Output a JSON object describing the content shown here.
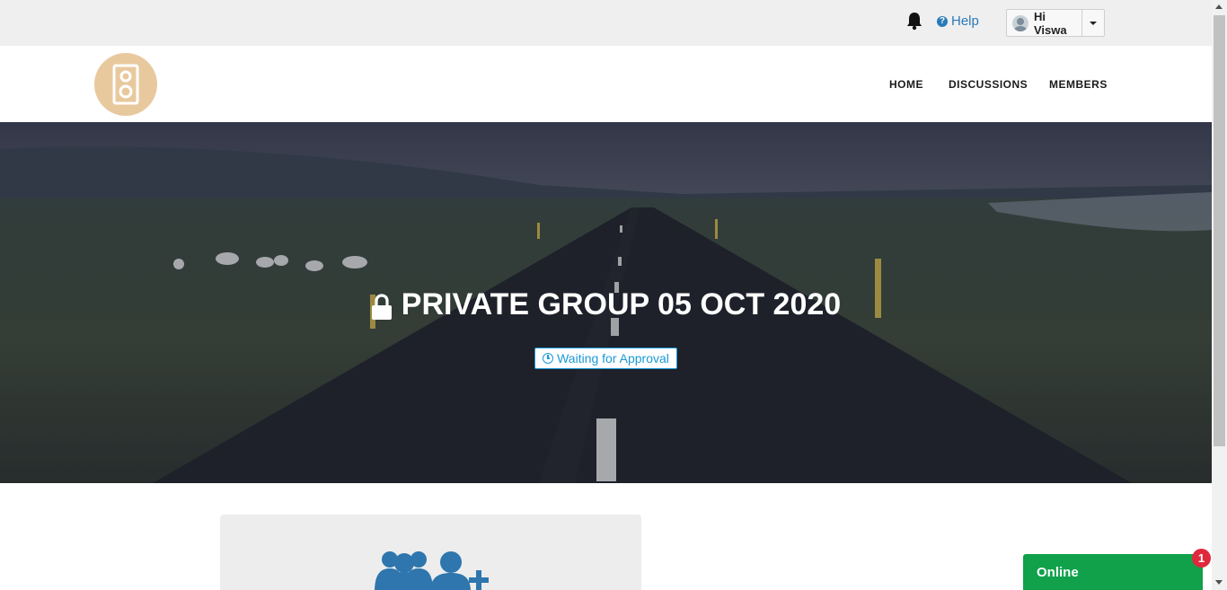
{
  "topbar": {
    "help_label": "Help",
    "user_greeting": "Hi Viswa"
  },
  "nav": {
    "items": [
      {
        "label": "HOME"
      },
      {
        "label": "DISCUSSIONS"
      },
      {
        "label": "MEMBERS"
      }
    ]
  },
  "hero": {
    "title": "PRIVATE GROUP 05 OCT 2020",
    "status": "Waiting for Approval"
  },
  "chat": {
    "label": "Online",
    "unread_count": "1"
  },
  "colors": {
    "link_blue": "#2a7ab8",
    "status_blue": "#1a9ad6",
    "logo_tan": "#e8c99e",
    "chat_green": "#10a14a",
    "badge_red": "#e0283c",
    "group_icon_blue": "#2e76ad"
  },
  "icons": {
    "notification": "bell-icon",
    "help": "question-circle-icon",
    "user": "avatar-icon",
    "logo": "speaker-icon",
    "title_lock": "lock-icon",
    "status": "clock-icon",
    "card": "group-add-icon"
  }
}
